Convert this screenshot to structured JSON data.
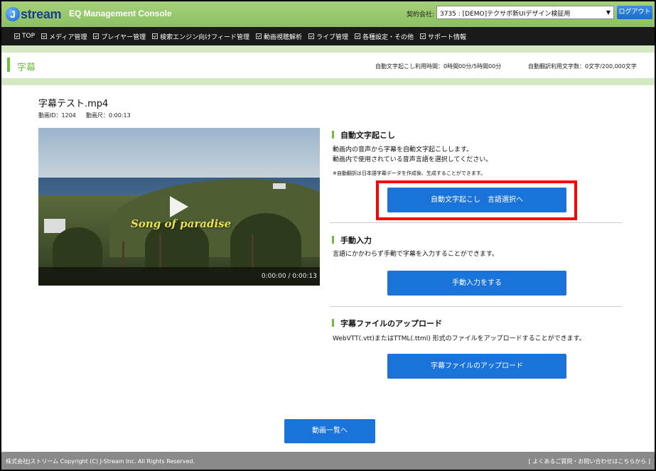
{
  "header": {
    "logo_letter": "J",
    "logo_text": "stream",
    "console_title": "EQ Management Console",
    "contract_label": "契約会社:",
    "contract_value": "3735 : [DEMO]テクサポ新UIデザイン検証用",
    "logout": "ログアウト"
  },
  "nav": {
    "items": [
      "TOP",
      "メディア管理",
      "プレイヤー管理",
      "検索エンジン向けフィード管理",
      "動画視聴解析",
      "ライブ管理",
      "各種設定・その他",
      "サポート情報"
    ]
  },
  "subheader": {
    "title": "字幕",
    "usage_transcription": "自動文字起こし利用時間：0時間00分/5時間00分",
    "usage_translation": "自動翻訳利用文字数：0文字/200,000文字"
  },
  "video": {
    "title": "字幕テスト.mp4",
    "id_label": "動画ID：1204",
    "length_label": "動画尺：0:00:13",
    "overlay_caption": "Song of paradise",
    "time": "0:00:00 / 0:00:13"
  },
  "sections": {
    "auto": {
      "title": "自動文字起こし",
      "desc1": "動画内の音声から字幕を自動文字起こしします。",
      "desc2": "動画内で使用されている音声言語を選択してください。",
      "note": "※自動翻訳は日本語字幕データを作成後、生成することができます。",
      "button": "自動文字起こし　言語選択へ"
    },
    "manual": {
      "title": "手動入力",
      "desc": "言語にかかわらず手動で字幕を入力することができます。",
      "button": "手動入力をする"
    },
    "upload": {
      "title": "字幕ファイルのアップロード",
      "desc": "WebVTT(.vtt)またはTTML(.ttml) 形式のファイルをアップロードすることができます。",
      "button": "字幕ファイルのアップロード"
    }
  },
  "back_button": "動画一覧へ",
  "footer": {
    "copyright": "株式会社Jストリーム  Copyright (C) J-Stream Inc. All Rights Reserved.",
    "help": "[ よくあるご質問・お問い合わせはこちらから ]"
  },
  "colors": {
    "accent_green": "#6dbf3d",
    "primary_blue": "#1a73d9",
    "highlight_red": "#ff0000"
  }
}
